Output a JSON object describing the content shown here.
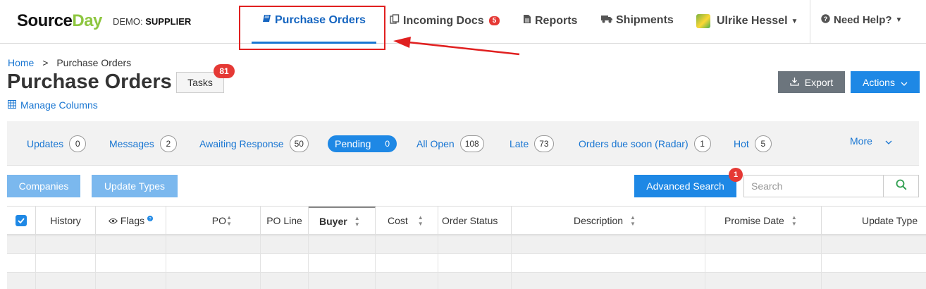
{
  "header": {
    "logo_main": "Source",
    "logo_accent": "Day",
    "demo_prefix": "DEMO:",
    "demo_role": "SUPPLIER",
    "nav": {
      "purchase_orders": "Purchase Orders",
      "incoming_docs": "Incoming Docs",
      "incoming_docs_count": "5",
      "reports": "Reports",
      "shipments": "Shipments",
      "user_name": "Ulrike Hessel",
      "help": "Need Help?"
    }
  },
  "breadcrumb": {
    "home": "Home",
    "separator": ">",
    "current": "Purchase Orders"
  },
  "page": {
    "title": "Purchase Orders",
    "tasks_label": "Tasks",
    "tasks_count": "81",
    "manage_columns": "Manage Columns",
    "export_label": "Export",
    "actions_label": "Actions"
  },
  "filters": [
    {
      "label": "Updates",
      "count": "0"
    },
    {
      "label": "Messages",
      "count": "2"
    },
    {
      "label": "Awaiting Response",
      "count": "50"
    },
    {
      "label": "Pending",
      "count": "0",
      "active": true
    },
    {
      "label": "All Open",
      "count": "108"
    },
    {
      "label": "Late",
      "count": "73"
    },
    {
      "label": "Orders due soon (Radar)",
      "count": "1"
    },
    {
      "label": "Hot",
      "count": "5"
    }
  ],
  "more_label": "More",
  "toolbar": {
    "companies": "Companies",
    "update_types": "Update Types",
    "advanced_search": "Advanced Search",
    "advanced_search_count": "1",
    "search_placeholder": "Search"
  },
  "table": {
    "columns": [
      "History",
      "Flags",
      "PO",
      "PO Line",
      "Buyer",
      "Cost",
      "Order Status",
      "Description",
      "Promise Date",
      "Update Type"
    ]
  },
  "colors": {
    "primary": "#1e88e5",
    "badge": "#e53935",
    "annotation": "#e02020",
    "logo_accent": "#8dc63f"
  }
}
